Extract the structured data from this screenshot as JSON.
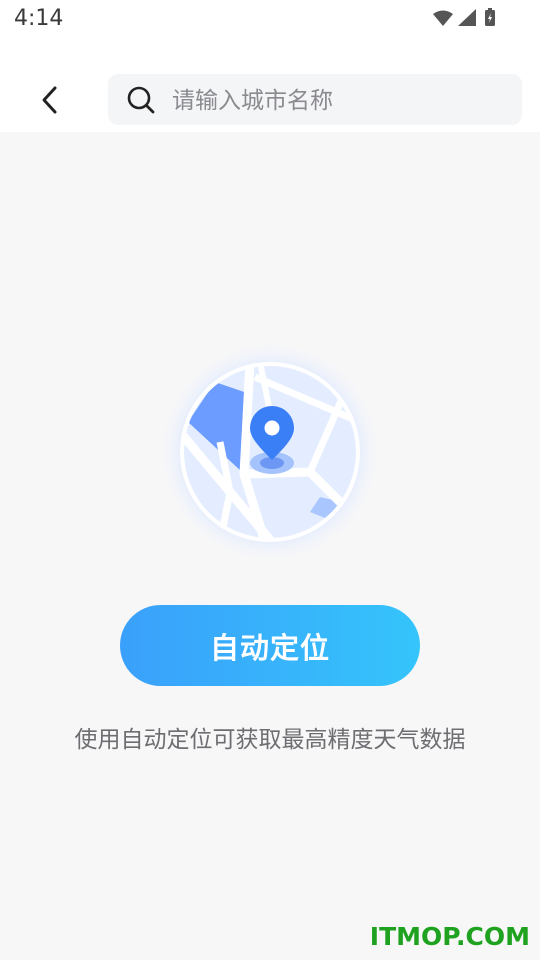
{
  "status_bar": {
    "time": "4:14",
    "icons": [
      "wifi-icon",
      "signal-icon",
      "battery-icon"
    ]
  },
  "header": {
    "back_icon": "chevron-left-icon",
    "search": {
      "icon": "search-icon",
      "placeholder": "请输入城市名称",
      "value": ""
    }
  },
  "main": {
    "illustration": "map-location-icon",
    "locate_button_label": "自动定位",
    "hint": "使用自动定位可获取最高精度天气数据"
  },
  "watermark": "ITMOP.COM",
  "colors": {
    "button_gradient_start": "#3aa0fb",
    "button_gradient_end": "#35c4fb",
    "pin": "#3a7ff6",
    "watermark": "#1fa21f"
  }
}
